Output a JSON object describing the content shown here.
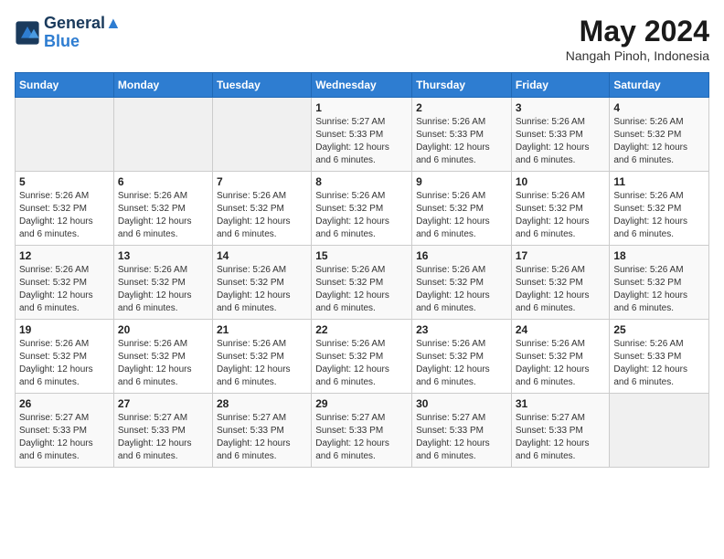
{
  "header": {
    "logo_line1": "General",
    "logo_line2": "Blue",
    "month_title": "May 2024",
    "location": "Nangah Pinoh, Indonesia"
  },
  "weekdays": [
    "Sunday",
    "Monday",
    "Tuesday",
    "Wednesday",
    "Thursday",
    "Friday",
    "Saturday"
  ],
  "weeks": [
    [
      {
        "day": "",
        "info": ""
      },
      {
        "day": "",
        "info": ""
      },
      {
        "day": "",
        "info": ""
      },
      {
        "day": "1",
        "info": "Sunrise: 5:27 AM\nSunset: 5:33 PM\nDaylight: 12 hours\nand 6 minutes."
      },
      {
        "day": "2",
        "info": "Sunrise: 5:26 AM\nSunset: 5:33 PM\nDaylight: 12 hours\nand 6 minutes."
      },
      {
        "day": "3",
        "info": "Sunrise: 5:26 AM\nSunset: 5:33 PM\nDaylight: 12 hours\nand 6 minutes."
      },
      {
        "day": "4",
        "info": "Sunrise: 5:26 AM\nSunset: 5:32 PM\nDaylight: 12 hours\nand 6 minutes."
      }
    ],
    [
      {
        "day": "5",
        "info": "Sunrise: 5:26 AM\nSunset: 5:32 PM\nDaylight: 12 hours\nand 6 minutes."
      },
      {
        "day": "6",
        "info": "Sunrise: 5:26 AM\nSunset: 5:32 PM\nDaylight: 12 hours\nand 6 minutes."
      },
      {
        "day": "7",
        "info": "Sunrise: 5:26 AM\nSunset: 5:32 PM\nDaylight: 12 hours\nand 6 minutes."
      },
      {
        "day": "8",
        "info": "Sunrise: 5:26 AM\nSunset: 5:32 PM\nDaylight: 12 hours\nand 6 minutes."
      },
      {
        "day": "9",
        "info": "Sunrise: 5:26 AM\nSunset: 5:32 PM\nDaylight: 12 hours\nand 6 minutes."
      },
      {
        "day": "10",
        "info": "Sunrise: 5:26 AM\nSunset: 5:32 PM\nDaylight: 12 hours\nand 6 minutes."
      },
      {
        "day": "11",
        "info": "Sunrise: 5:26 AM\nSunset: 5:32 PM\nDaylight: 12 hours\nand 6 minutes."
      }
    ],
    [
      {
        "day": "12",
        "info": "Sunrise: 5:26 AM\nSunset: 5:32 PM\nDaylight: 12 hours\nand 6 minutes."
      },
      {
        "day": "13",
        "info": "Sunrise: 5:26 AM\nSunset: 5:32 PM\nDaylight: 12 hours\nand 6 minutes."
      },
      {
        "day": "14",
        "info": "Sunrise: 5:26 AM\nSunset: 5:32 PM\nDaylight: 12 hours\nand 6 minutes."
      },
      {
        "day": "15",
        "info": "Sunrise: 5:26 AM\nSunset: 5:32 PM\nDaylight: 12 hours\nand 6 minutes."
      },
      {
        "day": "16",
        "info": "Sunrise: 5:26 AM\nSunset: 5:32 PM\nDaylight: 12 hours\nand 6 minutes."
      },
      {
        "day": "17",
        "info": "Sunrise: 5:26 AM\nSunset: 5:32 PM\nDaylight: 12 hours\nand 6 minutes."
      },
      {
        "day": "18",
        "info": "Sunrise: 5:26 AM\nSunset: 5:32 PM\nDaylight: 12 hours\nand 6 minutes."
      }
    ],
    [
      {
        "day": "19",
        "info": "Sunrise: 5:26 AM\nSunset: 5:32 PM\nDaylight: 12 hours\nand 6 minutes."
      },
      {
        "day": "20",
        "info": "Sunrise: 5:26 AM\nSunset: 5:32 PM\nDaylight: 12 hours\nand 6 minutes."
      },
      {
        "day": "21",
        "info": "Sunrise: 5:26 AM\nSunset: 5:32 PM\nDaylight: 12 hours\nand 6 minutes."
      },
      {
        "day": "22",
        "info": "Sunrise: 5:26 AM\nSunset: 5:32 PM\nDaylight: 12 hours\nand 6 minutes."
      },
      {
        "day": "23",
        "info": "Sunrise: 5:26 AM\nSunset: 5:32 PM\nDaylight: 12 hours\nand 6 minutes."
      },
      {
        "day": "24",
        "info": "Sunrise: 5:26 AM\nSunset: 5:32 PM\nDaylight: 12 hours\nand 6 minutes."
      },
      {
        "day": "25",
        "info": "Sunrise: 5:26 AM\nSunset: 5:33 PM\nDaylight: 12 hours\nand 6 minutes."
      }
    ],
    [
      {
        "day": "26",
        "info": "Sunrise: 5:27 AM\nSunset: 5:33 PM\nDaylight: 12 hours\nand 6 minutes."
      },
      {
        "day": "27",
        "info": "Sunrise: 5:27 AM\nSunset: 5:33 PM\nDaylight: 12 hours\nand 6 minutes."
      },
      {
        "day": "28",
        "info": "Sunrise: 5:27 AM\nSunset: 5:33 PM\nDaylight: 12 hours\nand 6 minutes."
      },
      {
        "day": "29",
        "info": "Sunrise: 5:27 AM\nSunset: 5:33 PM\nDaylight: 12 hours\nand 6 minutes."
      },
      {
        "day": "30",
        "info": "Sunrise: 5:27 AM\nSunset: 5:33 PM\nDaylight: 12 hours\nand 6 minutes."
      },
      {
        "day": "31",
        "info": "Sunrise: 5:27 AM\nSunset: 5:33 PM\nDaylight: 12 hours\nand 6 minutes."
      },
      {
        "day": "",
        "info": ""
      }
    ]
  ]
}
